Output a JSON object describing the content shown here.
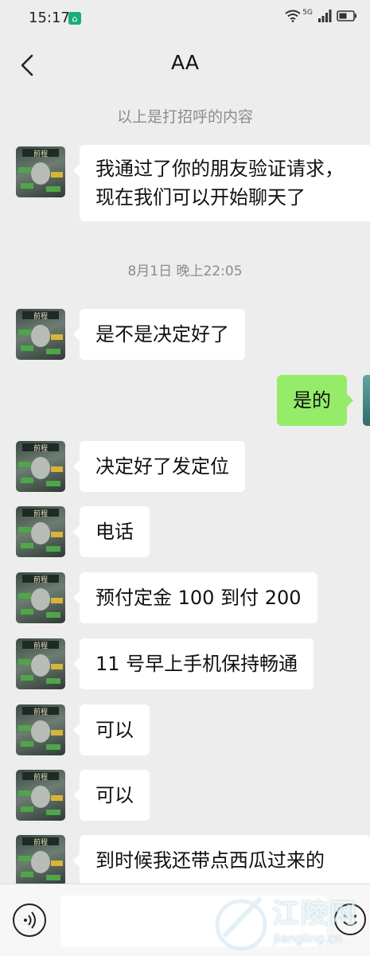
{
  "status_bar": {
    "time": "15:17",
    "network_label": "5G"
  },
  "header": {
    "title": "AA"
  },
  "messages": {
    "system_notice": "以上是打招呼的内容",
    "timestamp": "8月1日 晚上22:05",
    "items": [
      {
        "side": "left",
        "text_lines": [
          "我通过了你的朋友验证请求，",
          "现在我们可以开始聊天了"
        ]
      },
      {
        "side": "left",
        "text": "是不是决定好了"
      },
      {
        "side": "right",
        "text": "是的"
      },
      {
        "side": "left",
        "text": "决定好了发定位"
      },
      {
        "side": "left",
        "text": "电话"
      },
      {
        "side": "left",
        "text": "预付定金 100 到付 200"
      },
      {
        "side": "left",
        "text": "11 号早上手机保持畅通"
      },
      {
        "side": "left",
        "text": "可以"
      },
      {
        "side": "left",
        "text": "可以"
      },
      {
        "side": "left",
        "text": "到时候我还带点西瓜过来的"
      }
    ]
  },
  "input_bar": {
    "placeholder": ""
  },
  "watermark": {
    "name": "江陵网",
    "url": "jiangling.cn"
  },
  "colors": {
    "background": "#ededed",
    "bubble_left": "#ffffff",
    "bubble_right": "#95ec69",
    "system_text": "#8c8c8c"
  },
  "icons": [
    "back-arrow-icon",
    "wifi-icon",
    "signal-icon",
    "battery-icon",
    "voice-icon",
    "emoji-icon"
  ]
}
